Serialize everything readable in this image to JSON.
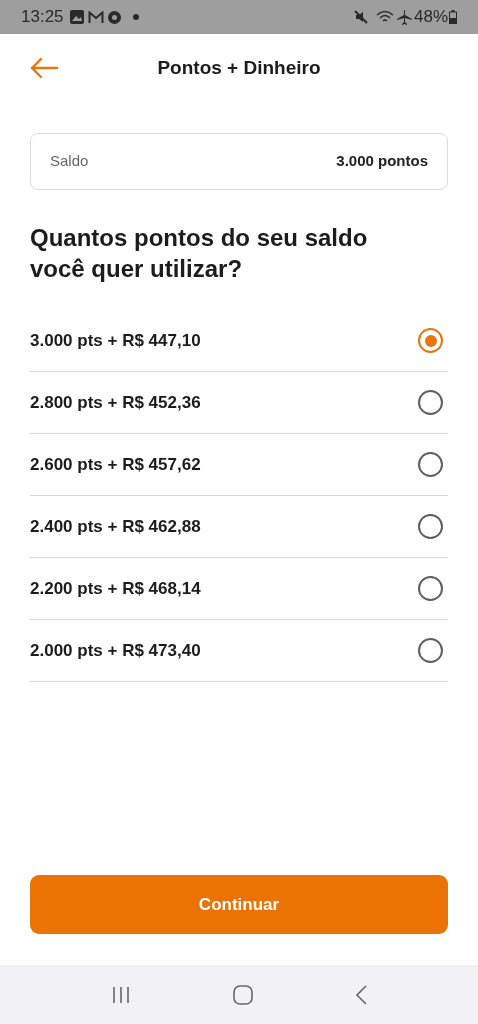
{
  "status_bar": {
    "time": "13:25",
    "battery": "48%"
  },
  "header": {
    "title": "Pontos + Dinheiro"
  },
  "balance": {
    "label": "Saldo",
    "value": "3.000 pontos"
  },
  "question": "Quantos pontos do seu saldo você quer utilizar?",
  "options": [
    {
      "label": "3.000 pts + R$ 447,10",
      "selected": true
    },
    {
      "label": "2.800 pts + R$ 452,36",
      "selected": false
    },
    {
      "label": "2.600 pts + R$ 457,62",
      "selected": false
    },
    {
      "label": "2.400 pts + R$ 462,88",
      "selected": false
    },
    {
      "label": "2.200 pts + R$ 468,14",
      "selected": false
    },
    {
      "label": "2.000 pts + R$ 473,40",
      "selected": false
    }
  ],
  "button": "Continuar"
}
